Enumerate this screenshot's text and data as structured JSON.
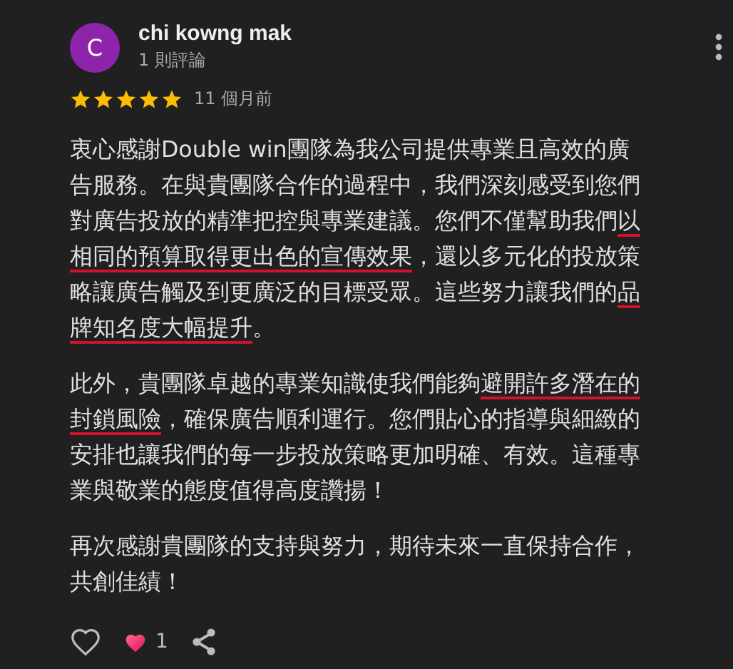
{
  "review": {
    "avatar_letter": "C",
    "author": "chi kowng mak",
    "review_count": "1 則評論",
    "stars": 5,
    "time": "11 個月前",
    "paragraphs": [
      [
        {
          "text": "衷心感謝Double win團隊為我公司提供專業且高效的廣告服務。在與貴團隊合作的過程中，我們深刻感受到您們對廣告投放的精準把控與專業建議。您們不僅幫助我們",
          "underlined": false
        },
        {
          "text": "以相同的預算取得更出色的宣傳效果",
          "underlined": true
        },
        {
          "text": "，還以多元化的投放策略讓廣告觸及到更廣泛的目標受眾。這些努力讓我們的",
          "underlined": false
        },
        {
          "text": "品牌知名度大幅提升",
          "underlined": true
        },
        {
          "text": "。",
          "underlined": false
        }
      ],
      [
        {
          "text": "此外，貴團隊卓越的專業知識使我們能夠",
          "underlined": false
        },
        {
          "text": "避開許多潛在的封鎖風險",
          "underlined": true
        },
        {
          "text": "，確保廣告順利運行。您們貼心的指導與細緻的安排也讓我們的每一步投放策略更加明確、有效。這種專業與敬業的態度值得高度讚揚！",
          "underlined": false
        }
      ],
      [
        {
          "text": "再次感謝貴團隊的支持與努力，期待未來一直保持合作，共創佳績！",
          "underlined": false
        }
      ]
    ],
    "reaction_count": "1",
    "liked": false
  }
}
